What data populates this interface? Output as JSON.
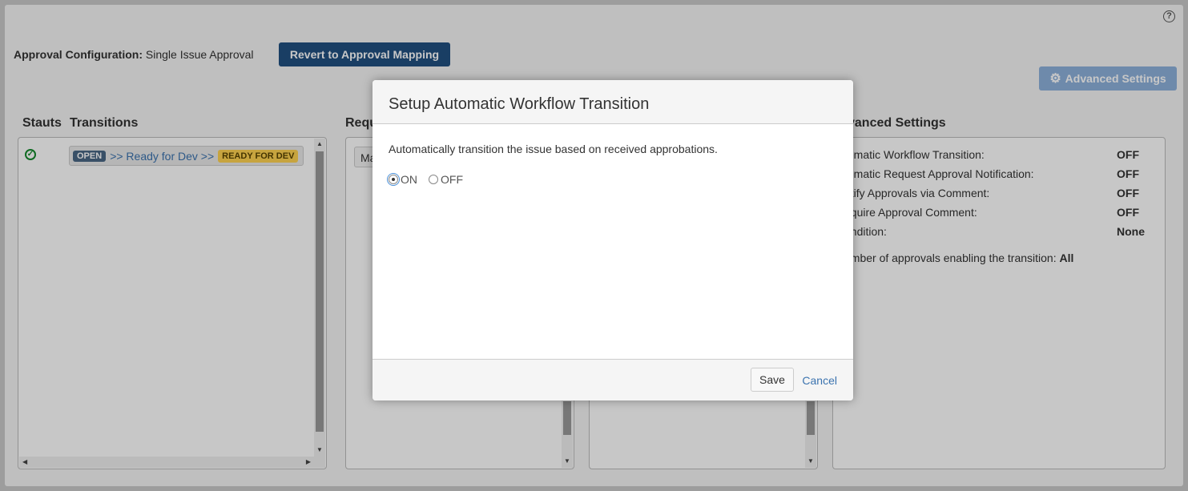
{
  "header": {
    "help_icon_glyph": "?",
    "config_label": "Approval Configuration:",
    "config_value": "Single Issue Approval",
    "revert_button": "Revert to Approval Mapping",
    "advanced_button": "Advanced Settings",
    "advanced_icon": "gear-icon"
  },
  "columns": {
    "status": "Stauts",
    "transitions": "Transitions",
    "requests": "Requ",
    "advanced": "vanced Settings"
  },
  "transitions": [
    {
      "status_icon": "check-circle-icon",
      "from": "OPEN",
      "middle": ">> Ready for Dev >>",
      "to": "READY FOR DEV"
    }
  ],
  "requests_panel": {
    "stub_text": "Ma"
  },
  "advanced_settings": {
    "rows": [
      {
        "label": "tomatic Workflow Transition:",
        "value": "OFF"
      },
      {
        "label": "tomatic Request Approval Notification:",
        "value": "OFF"
      },
      {
        "label": "otify Approvals via Comment:",
        "value": "OFF"
      },
      {
        "label": "equire Approval Comment:",
        "value": "OFF"
      },
      {
        "label": "ondition:",
        "value": "None"
      }
    ],
    "count_label": "umber of approvals enabling the transition:",
    "count_value": "All"
  },
  "dialog": {
    "title": "Setup Automatic Workflow Transition",
    "description": "Automatically transition the issue based on received approbations.",
    "options": [
      {
        "label": "ON",
        "selected": true
      },
      {
        "label": "OFF",
        "selected": false
      }
    ],
    "save_label": "Save",
    "cancel_label": "Cancel"
  },
  "colors": {
    "primary_button": "#205081",
    "disabled_button": "#8eb1dc",
    "open_lozenge": "#4a6785",
    "ready_lozenge": "#ffd351",
    "link": "#3b73af",
    "success": "#14892c"
  }
}
